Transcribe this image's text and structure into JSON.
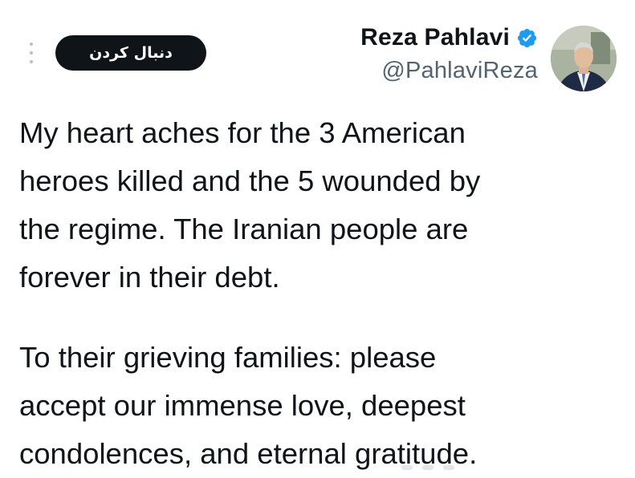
{
  "header": {
    "follow_button_label": "دنبال کردن",
    "display_name": "Reza Pahlavi",
    "handle": "@PahlaviReza",
    "verified_color": "#1d9bf0",
    "icons": [
      "more-options-icon",
      "verified-badge-icon"
    ]
  },
  "tweet": {
    "paragraphs": [
      {
        "lines": [
          "My heart aches for the 3 American",
          "heroes killed and the 5 wounded by",
          "the regime. The Iranian people are",
          "forever in their debt."
        ]
      },
      {
        "lines": [
          "To their grieving families: please",
          "accept our immense love, deepest",
          "condolences, and eternal gratitude."
        ]
      }
    ]
  },
  "colors": {
    "text": "#0f1419",
    "secondary": "#536471",
    "button_bg": "#0f1419",
    "button_text": "#ffffff",
    "background": "#ffffff"
  }
}
